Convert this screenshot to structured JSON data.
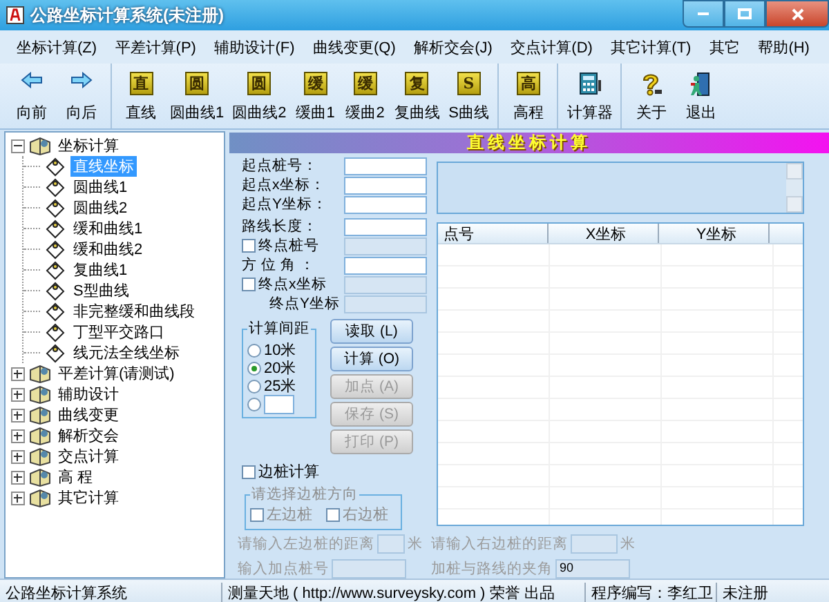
{
  "window": {
    "title": "公路坐标计算系统(未注册)"
  },
  "menu": [
    "坐标计算(Z)",
    "平差计算(P)",
    "辅助设计(F)",
    "曲线变更(Q)",
    "解析交会(J)",
    "交点计算(D)",
    "其它计算(T)",
    "其它",
    "帮助(H)"
  ],
  "toolbar": [
    [
      {
        "label": "向前",
        "kind": "back"
      },
      {
        "label": "向后",
        "kind": "forward"
      }
    ],
    [
      {
        "label": "直线",
        "kind": "glyph",
        "glyph": "直"
      },
      {
        "label": "圆曲线1",
        "kind": "glyph",
        "glyph": "圆"
      },
      {
        "label": "圆曲线2",
        "kind": "glyph",
        "glyph": "圆"
      },
      {
        "label": "缓曲1",
        "kind": "glyph",
        "glyph": "缓"
      },
      {
        "label": "缓曲2",
        "kind": "glyph",
        "glyph": "缓"
      },
      {
        "label": "复曲线",
        "kind": "glyph",
        "glyph": "复"
      },
      {
        "label": "S曲线",
        "kind": "glyph",
        "glyph": "S"
      }
    ],
    [
      {
        "label": "高程",
        "kind": "glyph",
        "glyph": "高"
      }
    ],
    [
      {
        "label": "计算器",
        "kind": "calculator"
      }
    ],
    [
      {
        "label": "关于",
        "kind": "help"
      },
      {
        "label": "退出",
        "kind": "exit"
      }
    ]
  ],
  "tree": [
    {
      "label": "坐标计算",
      "expanded": true,
      "selected": false,
      "children": [
        {
          "label": "直线坐标",
          "selected": true
        },
        {
          "label": "圆曲线1",
          "selected": false
        },
        {
          "label": "圆曲线2",
          "selected": false
        },
        {
          "label": "缓和曲线1",
          "selected": false
        },
        {
          "label": "缓和曲线2",
          "selected": false
        },
        {
          "label": "复曲线1",
          "selected": false
        },
        {
          "label": "S型曲线",
          "selected": false
        },
        {
          "label": "非完整缓和曲线段",
          "selected": false
        },
        {
          "label": "丁型平交路口",
          "selected": false
        },
        {
          "label": "线元法全线坐标",
          "selected": false
        }
      ]
    },
    {
      "label": "平差计算(请测试)",
      "expanded": false,
      "selected": false
    },
    {
      "label": "辅助设计",
      "expanded": false,
      "selected": false
    },
    {
      "label": "曲线变更",
      "expanded": false,
      "selected": false
    },
    {
      "label": "解析交会",
      "expanded": false,
      "selected": false
    },
    {
      "label": "交点计算",
      "expanded": false,
      "selected": false
    },
    {
      "label": "高 程",
      "expanded": false,
      "selected": false
    },
    {
      "label": "其它计算",
      "expanded": false,
      "selected": false
    }
  ],
  "panel_title": "直线坐标计算",
  "fields": [
    {
      "label": "起点桩号：",
      "kind": "input",
      "disabled": false
    },
    {
      "label": "起点x坐标：",
      "kind": "input",
      "disabled": false
    },
    {
      "label": "起点Y坐标：",
      "kind": "input",
      "disabled": false
    },
    {
      "label": "路线长度：",
      "kind": "input",
      "disabled": false
    },
    {
      "label": "终点桩号",
      "kind": "checkbox",
      "checked": false,
      "disabled": true
    },
    {
      "label": "方 位 角 ：",
      "kind": "input",
      "disabled": false
    },
    {
      "label": "终点x坐标",
      "kind": "checkbox",
      "checked": false,
      "disabled": true
    },
    {
      "label": "终点Y坐标",
      "kind": "plain",
      "disabled": true
    }
  ],
  "spacing": {
    "title": "计算间距",
    "options": [
      {
        "kind": "label",
        "label": "10米",
        "selected": false
      },
      {
        "kind": "label",
        "label": "20米",
        "selected": true
      },
      {
        "kind": "label",
        "label": "25米",
        "selected": false
      },
      {
        "kind": "input",
        "selected": false
      }
    ]
  },
  "buttons": [
    {
      "label": "读取 (L)",
      "disabled": false
    },
    {
      "label": "计算 (O)",
      "disabled": false
    },
    {
      "label": "加点 (A)",
      "disabled": true
    },
    {
      "label": "保存 (S)",
      "disabled": true
    },
    {
      "label": "打印 (P)",
      "disabled": true
    }
  ],
  "side_stakes": {
    "label": "边桩计算",
    "checked": false,
    "direction_title": "请选择边桩方向",
    "options": [
      {
        "label": "左边桩",
        "checked": false
      },
      {
        "label": "右边桩",
        "checked": false
      }
    ]
  },
  "table": {
    "columns": [
      "点号",
      "X坐标",
      "Y坐标"
    ]
  },
  "bottom": [
    {
      "label": "请输入左边桩的距离",
      "unit": "米",
      "disabled": true
    },
    {
      "label": "请输入右边桩的距离",
      "unit": "米",
      "disabled": true
    },
    {
      "label": "输入加点桩号",
      "disabled": true
    },
    {
      "label": "加桩与路线的夹角",
      "value": "90",
      "disabled": true
    }
  ],
  "status_bar": [
    "公路坐标计算系统",
    "测量天地 ( http://www.surveysky.com ) 荣誉 出品",
    "程序编写：李红卫",
    "未注册"
  ]
}
